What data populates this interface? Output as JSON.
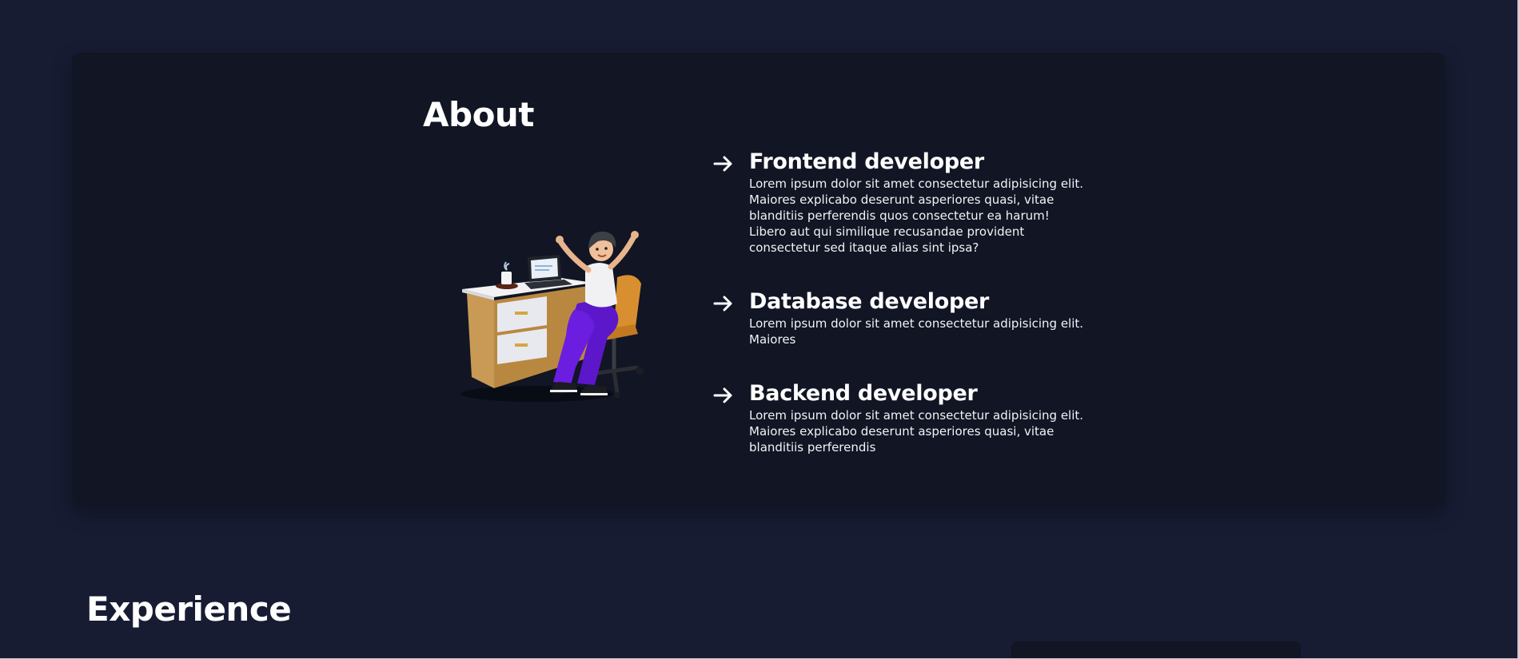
{
  "about": {
    "title": "About",
    "illustration": "developer-at-desk-illustration",
    "skills": [
      {
        "icon": "arrow-right-icon",
        "title": "Frontend developer",
        "description": "Lorem ipsum dolor sit amet consectetur adipisicing elit. Maiores explicabo deserunt asperiores quasi, vitae blanditiis perferendis quos consectetur ea harum! Libero aut qui similique recusandae provident consectetur sed itaque alias sint ipsa?"
      },
      {
        "icon": "arrow-right-icon",
        "title": "Database developer",
        "description": "Lorem ipsum dolor sit amet consectetur adipisicing elit. Maiores"
      },
      {
        "icon": "arrow-right-icon",
        "title": "Backend developer",
        "description": "Lorem ipsum dolor sit amet consectetur adipisicing elit. Maiores explicabo deserunt asperiores quasi, vitae blanditiis perferendis"
      }
    ]
  },
  "experience": {
    "title": "Experience"
  },
  "colors": {
    "page_background": "#171c33",
    "card_background": "#111524",
    "text": "#ffffff",
    "pants": "#6b1de0",
    "chair": "#d88f2f",
    "desk_wood": "#c99a55"
  }
}
